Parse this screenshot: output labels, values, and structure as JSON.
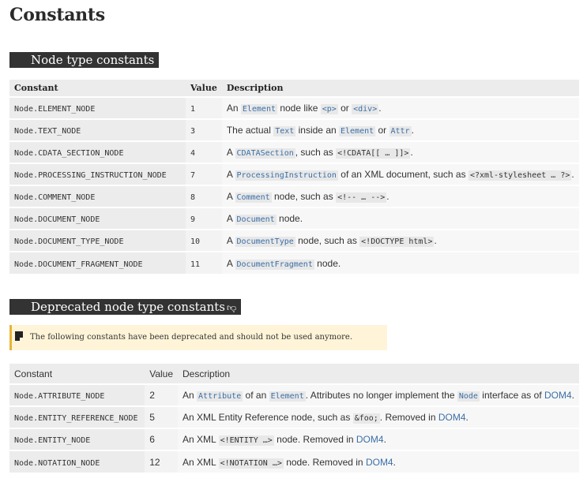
{
  "page": {
    "title": "Constants"
  },
  "section1": {
    "heading": "Node type constants",
    "headers": [
      "Constant",
      "Value",
      "Description"
    ],
    "rows": [
      {
        "constant": "Node.ELEMENT_NODE",
        "value": "1",
        "parts": [
          [
            "t",
            "An "
          ],
          [
            "c",
            "Element"
          ],
          [
            "t",
            " node like "
          ],
          [
            "c",
            "<p>"
          ],
          [
            "t",
            " or "
          ],
          [
            "c",
            "<div>"
          ],
          [
            "t",
            "."
          ]
        ]
      },
      {
        "constant": "Node.TEXT_NODE",
        "value": "3",
        "parts": [
          [
            "t",
            "The actual "
          ],
          [
            "c",
            "Text"
          ],
          [
            "t",
            " inside an "
          ],
          [
            "c",
            "Element"
          ],
          [
            "t",
            " or "
          ],
          [
            "c",
            "Attr"
          ],
          [
            "t",
            "."
          ]
        ]
      },
      {
        "constant": "Node.CDATA_SECTION_NODE",
        "value": "4",
        "parts": [
          [
            "t",
            "A "
          ],
          [
            "c",
            "CDATASection"
          ],
          [
            "t",
            ", such as "
          ],
          [
            "p",
            "<!CDATA[[ … ]]>"
          ],
          [
            "t",
            "."
          ]
        ]
      },
      {
        "constant": "Node.PROCESSING_INSTRUCTION_NODE",
        "value": "7",
        "parts": [
          [
            "t",
            "A "
          ],
          [
            "c",
            "ProcessingInstruction"
          ],
          [
            "t",
            " of an XML document, such as "
          ],
          [
            "p",
            "<?xml-stylesheet … ?>"
          ],
          [
            "t",
            "."
          ]
        ]
      },
      {
        "constant": "Node.COMMENT_NODE",
        "value": "8",
        "parts": [
          [
            "t",
            "A "
          ],
          [
            "c",
            "Comment"
          ],
          [
            "t",
            " node, such as "
          ],
          [
            "p",
            "<!-- … -->"
          ],
          [
            "t",
            "."
          ]
        ]
      },
      {
        "constant": "Node.DOCUMENT_NODE",
        "value": "9",
        "parts": [
          [
            "t",
            "A "
          ],
          [
            "c",
            "Document"
          ],
          [
            "t",
            " node."
          ]
        ]
      },
      {
        "constant": "Node.DOCUMENT_TYPE_NODE",
        "value": "10",
        "parts": [
          [
            "t",
            "A "
          ],
          [
            "c",
            "DocumentType"
          ],
          [
            "t",
            " node, such as "
          ],
          [
            "p",
            "<!DOCTYPE html>"
          ],
          [
            "t",
            "."
          ]
        ]
      },
      {
        "constant": "Node.DOCUMENT_FRAGMENT_NODE",
        "value": "11",
        "parts": [
          [
            "t",
            "A "
          ],
          [
            "c",
            "DocumentFragment"
          ],
          [
            "t",
            " node."
          ]
        ]
      }
    ]
  },
  "section2": {
    "heading": "Deprecated node type constants",
    "thumb_icon": "thumbs-down-icon",
    "note_icon": "note-icon",
    "note": "The following constants have been deprecated and should not be used anymore.",
    "headers": [
      "Constant",
      "Value",
      "Description"
    ],
    "rows": [
      {
        "constant": "Node.ATTRIBUTE_NODE",
        "value": "2",
        "parts": [
          [
            "t",
            "An "
          ],
          [
            "c",
            "Attribute"
          ],
          [
            "t",
            " of an "
          ],
          [
            "c",
            "Element"
          ],
          [
            "t",
            ". Attributes no longer implement the "
          ],
          [
            "c",
            "Node"
          ],
          [
            "t",
            " interface as of "
          ],
          [
            "l",
            "DOM4"
          ],
          [
            "t",
            "."
          ]
        ]
      },
      {
        "constant": "Node.ENTITY_REFERENCE_NODE",
        "value": "5",
        "parts": [
          [
            "t",
            "An XML Entity Reference node, such as "
          ],
          [
            "p",
            "&foo;"
          ],
          [
            "t",
            ". Removed in "
          ],
          [
            "l",
            "DOM4"
          ],
          [
            "t",
            "."
          ]
        ]
      },
      {
        "constant": "Node.ENTITY_NODE",
        "value": "6",
        "parts": [
          [
            "t",
            "An XML "
          ],
          [
            "p",
            "<!ENTITY …>"
          ],
          [
            "t",
            " node. Removed in "
          ],
          [
            "l",
            "DOM4"
          ],
          [
            "t",
            "."
          ]
        ]
      },
      {
        "constant": "Node.NOTATION_NODE",
        "value": "12",
        "parts": [
          [
            "t",
            "An XML "
          ],
          [
            "p",
            "<!NOTATION …>"
          ],
          [
            "t",
            " node. Removed in "
          ],
          [
            "l",
            "DOM4"
          ],
          [
            "t",
            "."
          ]
        ]
      }
    ]
  }
}
